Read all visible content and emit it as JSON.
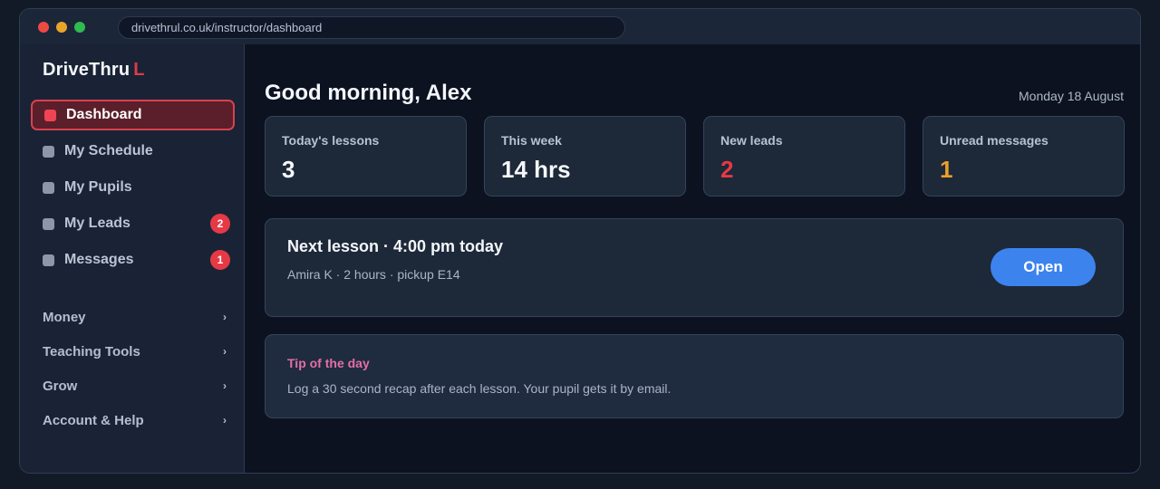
{
  "browser": {
    "url": "drivethrul.co.uk/instructor/dashboard"
  },
  "sidebar": {
    "logo_main": "DriveThru",
    "logo_accent": "L",
    "nav": [
      {
        "label": "Dashboard",
        "active": true
      },
      {
        "label": "My Schedule"
      },
      {
        "label": "My Pupils"
      },
      {
        "label": "My Leads",
        "badge": "2"
      },
      {
        "label": "Messages",
        "badge": "1"
      }
    ],
    "groups": [
      {
        "label": "Money",
        "icon": "chevron-right-icon"
      },
      {
        "label": "Teaching Tools",
        "icon": "chevron-right-icon"
      },
      {
        "label": "Grow",
        "icon": "chevron-right-icon"
      },
      {
        "label": "Account & Help",
        "icon": "chevron-right-icon"
      }
    ],
    "chevron": "›"
  },
  "main": {
    "greeting": "Good morning, Alex",
    "date": "Monday 18 August",
    "stats": [
      {
        "label": "Today's lessons",
        "value": "3",
        "color": "#f5f7fb"
      },
      {
        "label": "This week",
        "value": "14 hrs",
        "color": "#f5f7fb"
      },
      {
        "label": "New leads",
        "value": "2",
        "color": "#e63946"
      },
      {
        "label": "Unread messages",
        "value": "1",
        "color": "#e9a02b"
      }
    ],
    "next_lesson": {
      "title": "Next lesson · 4:00 pm today",
      "detail": "Amira K · 2 hours · pickup E14",
      "button": "Open"
    },
    "tip": {
      "title": "Tip of the day",
      "text": "Log a 30 second recap after each lesson. Your pupil gets it by email."
    }
  },
  "colors": {
    "accent": "#e03b45",
    "primary_button": "#3c83ee",
    "tip_title": "#e36fa6"
  }
}
